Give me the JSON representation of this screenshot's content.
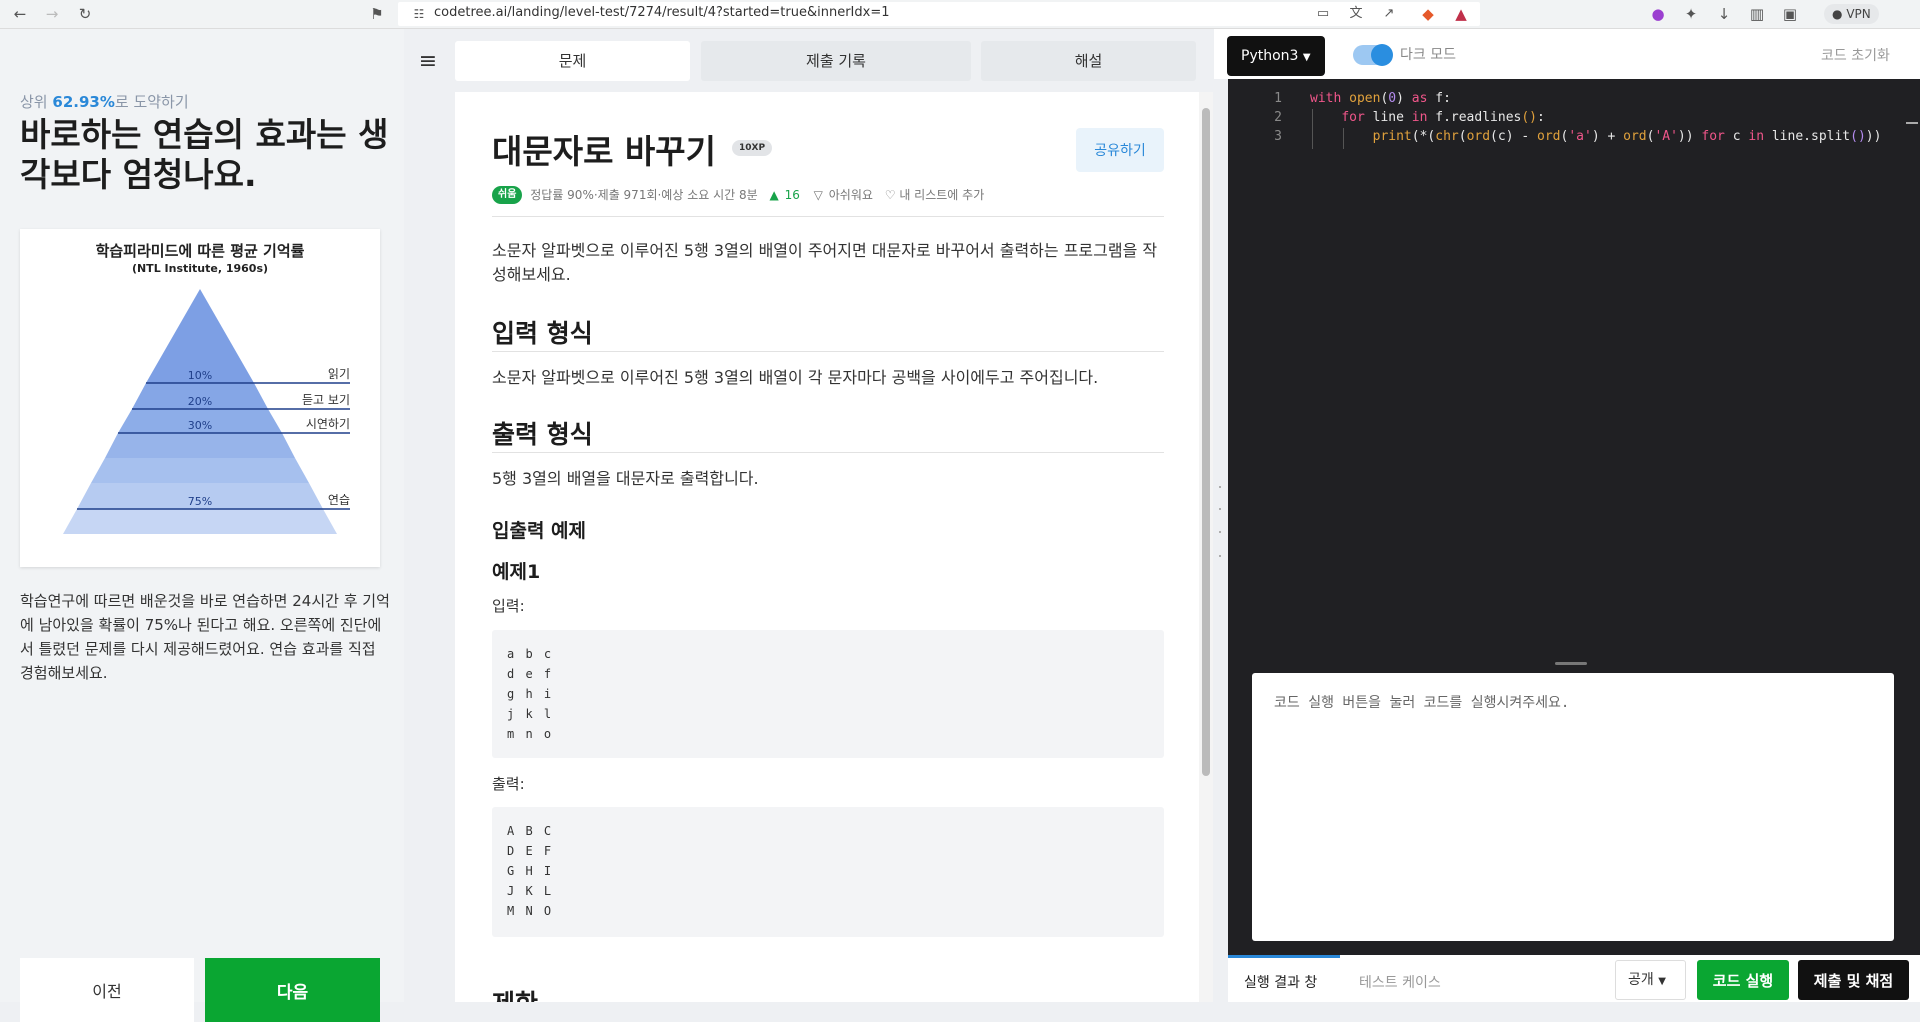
{
  "browser": {
    "url": "codetree.ai/landing/level-test/7274/result/4?started=true&innerIdx=1",
    "vpn_label": "VPN"
  },
  "left": {
    "rank_prefix": "상위",
    "rank_pct": "62.93%",
    "rank_suffix": "로 도약하기",
    "headline": "바로하는 연습의 효과는 생각보다 엄청나요.",
    "pyramid": {
      "title": "학습피라미드에 따른 평균 기억률",
      "subtitle": "(NTL Institute, 1960s)",
      "levels": [
        {
          "pct": "10%",
          "label": "읽기"
        },
        {
          "pct": "20%",
          "label": "듣고 보기"
        },
        {
          "pct": "30%",
          "label": "시연하기"
        },
        {
          "pct": "75%",
          "label": "연습"
        }
      ]
    },
    "description": "학습연구에 따르면 배운것을 바로 연습하면 24시간 후 기억에 남아있을 확률이 75%나 된다고 해요. 오른쪽에 진단에서 틀렸던 문제를 다시 제공해드렸어요. 연습 효과를 직접 경험해보세요.",
    "prev_label": "이전",
    "next_label": "다음"
  },
  "tabs": {
    "problem": "문제",
    "history": "제출 기록",
    "solution": "해설"
  },
  "problem": {
    "title": "대문자로 바꾸기",
    "xp": "10XP",
    "share_label": "공유하기",
    "level": "쉬움",
    "meta": "정답률 90%·제출 971회·예상 소요 시간 8분",
    "likes": "16",
    "dislike_label": "아쉬워요",
    "add_list_label": "내 리스트에 추가",
    "statement": "소문자 알파벳으로 이루어진 5행 3열의 배열이 주어지면 대문자로 바꾸어서 출력하는 프로그램을 작성해보세요.",
    "input_heading": "입력 형식",
    "input_text": "소문자 알파벳으로 이루어진 5행 3열의 배열이 각 문자마다 공백을 사이에두고 주어집니다.",
    "output_heading": "출력 형식",
    "output_text": "5행 3열의 배열을 대문자로 출력합니다.",
    "examples_heading": "입출력 예제",
    "example1_heading": "예제1",
    "input_label": "입력:",
    "example_input": "a b c\nd e f\ng h i\nj k l\nm n o",
    "output_label": "출력:",
    "example_output": "A B C\nD E F\nG H I\nJ K L\nM N O",
    "constraints_heading": "제한"
  },
  "editor": {
    "language": "Python3",
    "dark_mode_label": "다크 모드",
    "reset_label": "코드 초기화",
    "line_numbers": [
      "1",
      "2",
      "3"
    ],
    "output_placeholder": "코드 실행 버튼을 눌러 코드를 실행시켜주세요.",
    "tab_result": "실행 결과 창",
    "tab_testcase": "테스트 케이스",
    "visibility": "공개",
    "run_label": "코드 실행",
    "submit_label": "제출 및 채점"
  }
}
